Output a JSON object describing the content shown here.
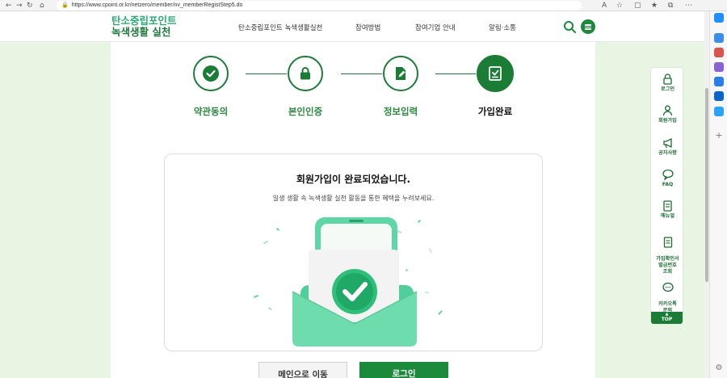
{
  "browser": {
    "url": "https://www.cpoint.or.kr/netzero/member/nv_memberRegistStep5.do",
    "lock_symbol": "🔒"
  },
  "header": {
    "logo_line1": "탄소중립포인트",
    "logo_line2": "녹색생활 실천",
    "nav": [
      "탄소중립포인트 녹색생활실천",
      "참여방법",
      "참여기업 안내",
      "알림·소통"
    ]
  },
  "steps": [
    {
      "label": "약관동의",
      "icon": "check-icon",
      "state": "done"
    },
    {
      "label": "본인인증",
      "icon": "lock-icon",
      "state": "done"
    },
    {
      "label": "정보입력",
      "icon": "edit-document-icon",
      "state": "done"
    },
    {
      "label": "가입완료",
      "icon": "complete-document-icon",
      "state": "active"
    }
  ],
  "card": {
    "title": "회원가입이 완료되었습니다.",
    "subtitle": "일생 생활 속 녹색생활 실천 활동을 통한 혜택을 누려보세요."
  },
  "buttons": {
    "main": "메인으로 이동",
    "login": "로그인"
  },
  "quick_menu": [
    {
      "label": "로그인",
      "icon": "lock-icon"
    },
    {
      "label": "회원가입",
      "icon": "user-icon"
    },
    {
      "label": "공지사항",
      "icon": "megaphone-icon"
    },
    {
      "label": "FAQ",
      "icon": "faq-chat-icon"
    },
    {
      "label": "매뉴얼",
      "icon": "manual-icon"
    },
    {
      "label": "가입확인서\n발급번호\n조회",
      "icon": "certificate-icon"
    },
    {
      "label": "카카오톡\n문의",
      "icon": "kakao-chat-icon"
    }
  ],
  "quick_top": "TOP",
  "colors": {
    "brand_green": "#1b8a3a",
    "step_green": "#1b7c35",
    "mint": "#5fd6a6"
  }
}
